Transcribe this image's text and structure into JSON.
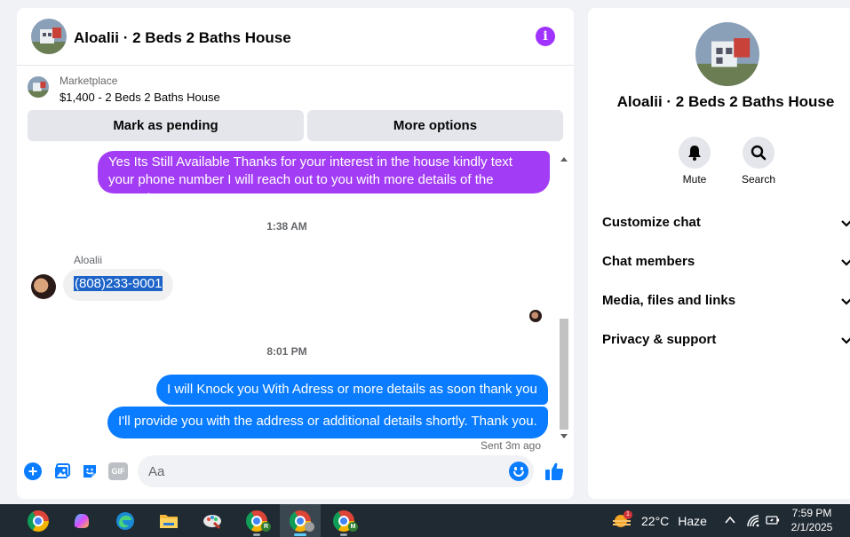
{
  "header": {
    "title": "Aloalii · 2 Beds 2 Baths House"
  },
  "listing": {
    "source": "Marketplace",
    "price_title": "$1,400 - 2 Beds 2 Baths House"
  },
  "actions": {
    "mark_pending": "Mark as pending",
    "more_options": "More options"
  },
  "messages": {
    "first_outgoing": "Yes Its Still Available Thanks for your interest in the house kindly text your phone number  I will reach out to you with more details of the property.",
    "time_1": "1:38 AM",
    "sender": "Aloalii",
    "incoming": "(808)233-9001",
    "time_2": "8:01 PM",
    "outgoing_1": "I will Knock you With Adress or more details  as soon thank you",
    "outgoing_2": "I'll provide you with the address or additional details shortly. Thank you.",
    "status": "Sent 3m ago"
  },
  "composer": {
    "placeholder": "Aa",
    "gif_label": "GIF"
  },
  "info_panel": {
    "title": "Aloalii · 2 Beds 2 Baths House",
    "mute_label": "Mute",
    "search_label": "Search",
    "sections": [
      "Customize chat",
      "Chat members",
      "Media, files and links",
      "Privacy & support"
    ]
  },
  "taskbar": {
    "weather_temp": "22°C",
    "weather_condition": "Haze",
    "weather_badge": "1",
    "time": "7:59 PM",
    "date": "2/1/2025",
    "profile_badges": [
      "R",
      "M"
    ]
  },
  "colors": {
    "messenger_blue": "#0a7cff",
    "purple_bubble": "#a33df5",
    "info_purple": "#a033ff"
  }
}
